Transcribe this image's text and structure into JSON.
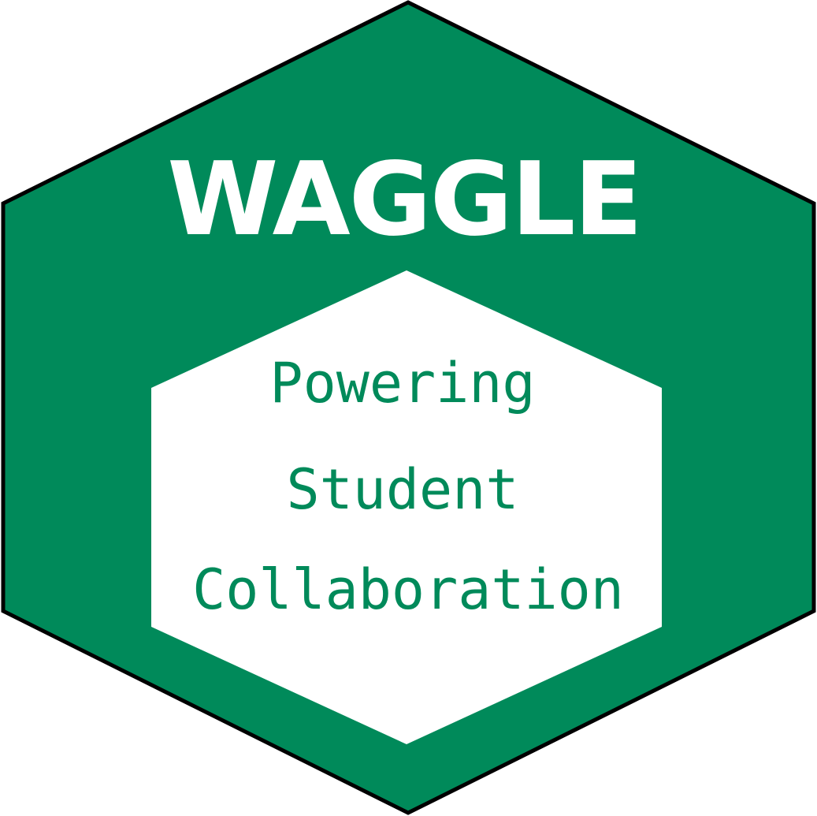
{
  "logo": {
    "title": "WAGGLE",
    "tagline": [
      "Powering",
      "Student",
      "Collaboration"
    ],
    "colors": {
      "brand_green": "#008a5a",
      "inner_fill": "#ffffff",
      "title_text": "#ffffff",
      "tagline_text": "#008a5a",
      "outline": "#000000"
    },
    "icon": "hexagon-badge-icon"
  }
}
